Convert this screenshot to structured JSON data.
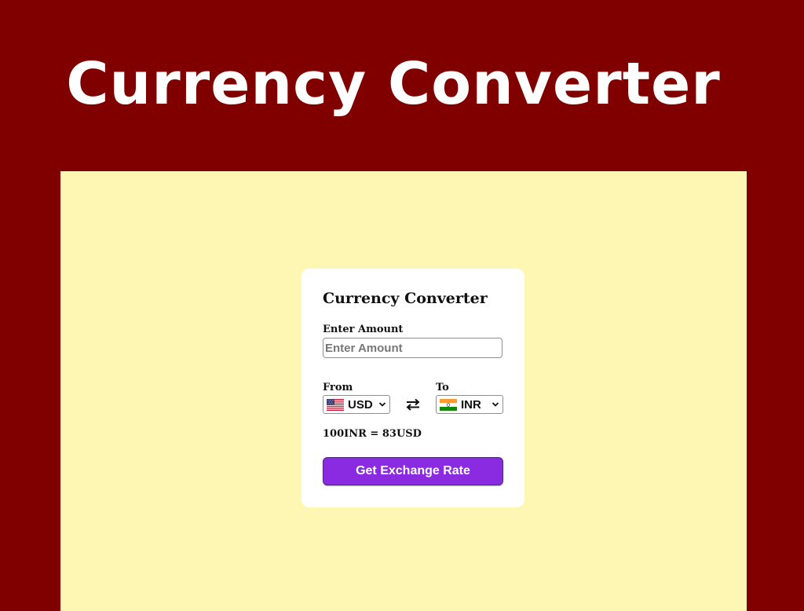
{
  "banner": {
    "title": "Currency Converter"
  },
  "card": {
    "title": "Currency Converter",
    "amount_label": "Enter Amount",
    "amount_placeholder": "Enter Amount",
    "amount_value": "",
    "from_label": "From",
    "to_label": "To",
    "from_currency": {
      "code": "USD",
      "flag_icon": "us-flag-icon"
    },
    "to_currency": {
      "code": "INR",
      "flag_icon": "india-flag-icon"
    },
    "swap_icon": "swap-arrows-icon",
    "rate_message": "100INR = 83USD",
    "button_label": "Get Exchange Rate"
  },
  "colors": {
    "page_background": "#800000",
    "stage_background": "#fef7b4",
    "card_background": "#ffffff",
    "button_background": "#8a2be2",
    "button_text": "#ffffff"
  }
}
